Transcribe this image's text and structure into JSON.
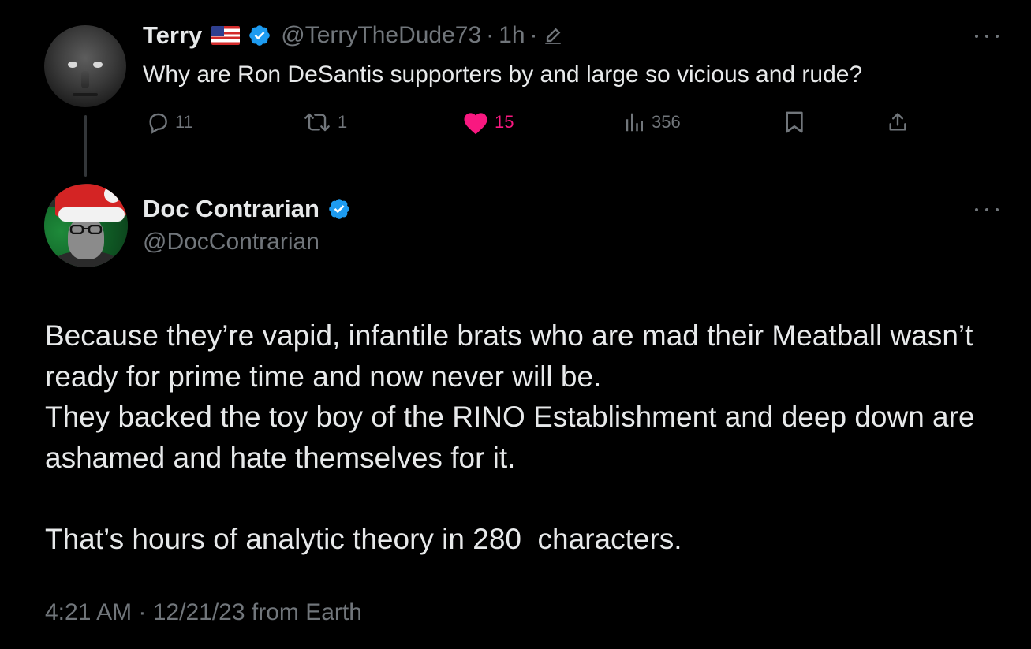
{
  "parent_tweet": {
    "display_name": "Terry",
    "flag_icon": "us-flag-icon",
    "handle": "@TerryTheDude73",
    "time_ago": "1h",
    "separator": "·",
    "text": "Why are Ron DeSantis supporters by and large so vicious and rude?",
    "actions": {
      "replies": "11",
      "reposts": "1",
      "likes": "15",
      "views": "356"
    }
  },
  "main_tweet": {
    "display_name": "Doc Contrarian",
    "handle": "@DocContrarian",
    "lines": [
      "Because they’re vapid, infantile brats who are mad their Meatball wasn’t ready for prime time and now never will be.",
      "They backed the toy boy of the RINO Establishment and deep down are ashamed and hate themselves for it.",
      "",
      "That’s hours of analytic theory in 280  characters."
    ],
    "time": "4:21 AM",
    "date": "12/21/23",
    "source": "from Earth",
    "separator": "·"
  },
  "colors": {
    "background": "#000000",
    "text": "#e7e9ea",
    "muted": "#71767b",
    "verified_blue": "#1d9bf0",
    "like_pink": "#f91880",
    "thread_line": "#333639"
  }
}
